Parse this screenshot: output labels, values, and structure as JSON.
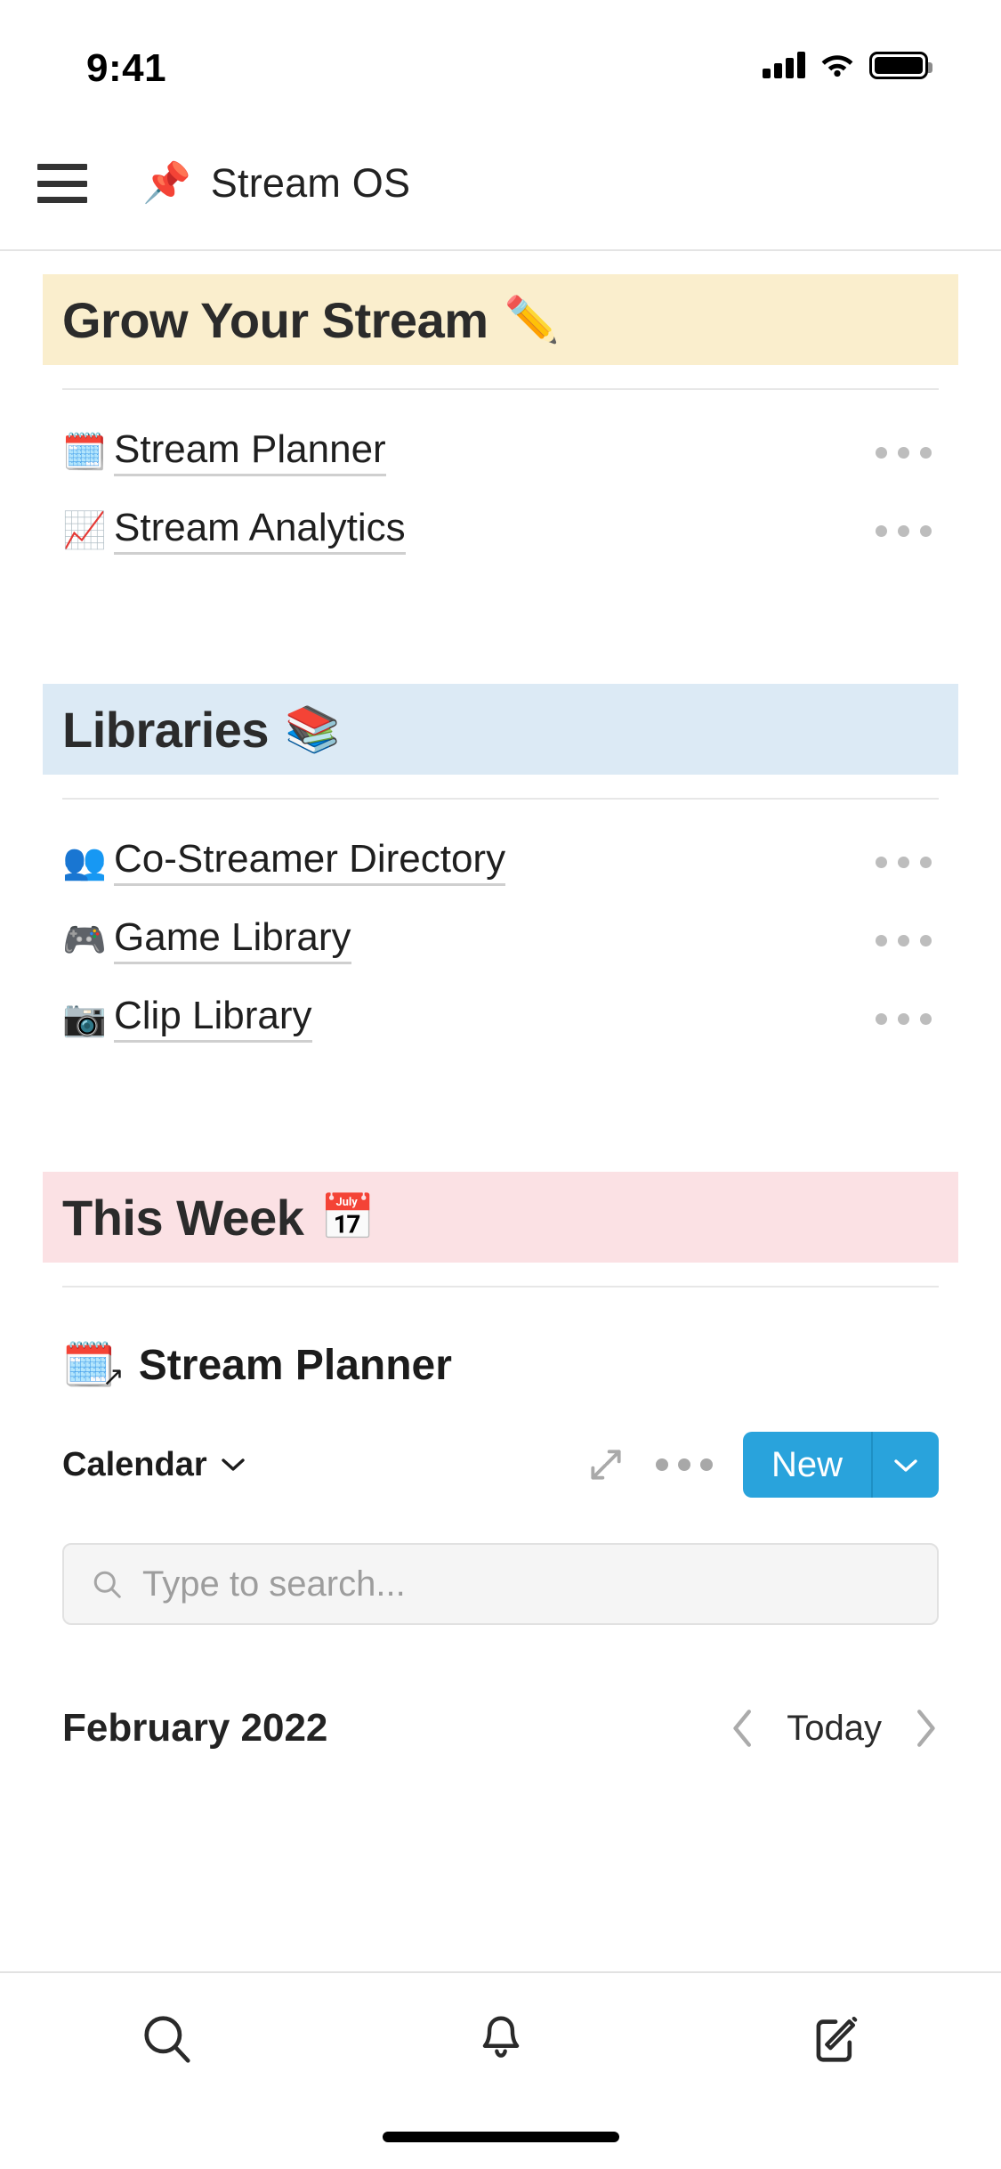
{
  "status_bar": {
    "time": "9:41",
    "icons": [
      "cellular-signal-icon",
      "wifi-icon",
      "battery-icon"
    ]
  },
  "header": {
    "menu_icon": "hamburger-menu-icon",
    "emoji": "📌",
    "title": "Stream OS"
  },
  "sections": [
    {
      "id": "grow-your-stream",
      "title": "Grow Your Stream",
      "emoji": "✏️",
      "banner_color": "#faeecd",
      "items": [
        {
          "emoji": "🗓️",
          "label": "Stream Planner",
          "menu": "overflow-menu-icon"
        },
        {
          "emoji": "📈",
          "label": "Stream Analytics",
          "menu": "overflow-menu-icon"
        }
      ]
    },
    {
      "id": "libraries",
      "title": "Libraries",
      "emoji": "📚",
      "banner_color": "#dceaf5",
      "items": [
        {
          "emoji": "👥",
          "label": "Co-Streamer Directory",
          "menu": "overflow-menu-icon"
        },
        {
          "emoji": "🎮",
          "label": "Game Library",
          "menu": "overflow-menu-icon"
        },
        {
          "emoji": "📷",
          "label": "Clip Library",
          "menu": "overflow-menu-icon"
        }
      ]
    },
    {
      "id": "this-week",
      "title": "This Week",
      "emoji": "📅",
      "banner_color": "#fbe1e4",
      "items": []
    }
  ],
  "embed": {
    "emoji": "🗓️",
    "link_arrow": "↗",
    "title": "Stream Planner",
    "view_select": {
      "label": "Calendar",
      "caret_icon": "chevron-down-icon"
    },
    "expand_icon": "expand-arrows-icon",
    "overflow_icon": "overflow-menu-icon",
    "new_button": {
      "label": "New",
      "caret_icon": "chevron-down-icon",
      "color": "#29a3dc"
    },
    "search": {
      "icon": "search-icon",
      "placeholder": "Type to search..."
    },
    "calendar_nav": {
      "month": "February 2022",
      "prev_icon": "chevron-left-icon",
      "today_label": "Today",
      "next_icon": "chevron-right-icon"
    }
  },
  "tabbar": {
    "tabs": [
      {
        "name": "search",
        "icon": "search-icon"
      },
      {
        "name": "notifications",
        "icon": "bell-icon"
      },
      {
        "name": "compose",
        "icon": "compose-icon"
      }
    ]
  }
}
